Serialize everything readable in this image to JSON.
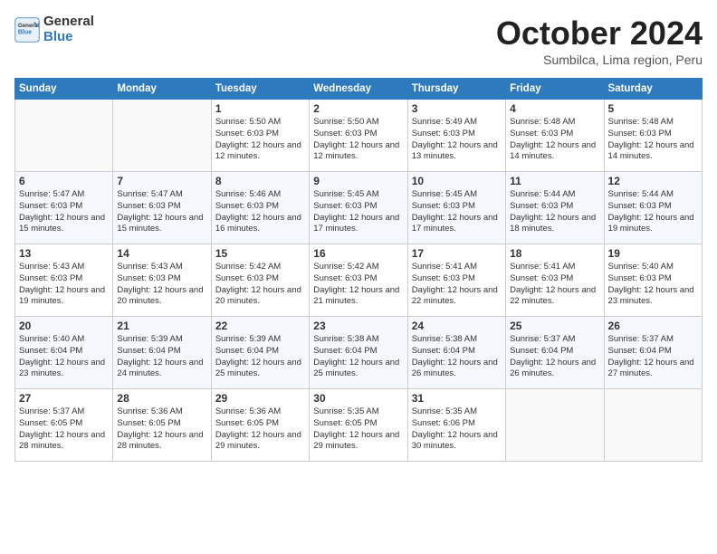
{
  "header": {
    "logo_general": "General",
    "logo_blue": "Blue",
    "month_title": "October 2024",
    "subtitle": "Sumbilca, Lima region, Peru"
  },
  "weekdays": [
    "Sunday",
    "Monday",
    "Tuesday",
    "Wednesday",
    "Thursday",
    "Friday",
    "Saturday"
  ],
  "weeks": [
    [
      {
        "day": "",
        "info": ""
      },
      {
        "day": "",
        "info": ""
      },
      {
        "day": "1",
        "info": "Sunrise: 5:50 AM\nSunset: 6:03 PM\nDaylight: 12 hours and 12 minutes."
      },
      {
        "day": "2",
        "info": "Sunrise: 5:50 AM\nSunset: 6:03 PM\nDaylight: 12 hours and 12 minutes."
      },
      {
        "day": "3",
        "info": "Sunrise: 5:49 AM\nSunset: 6:03 PM\nDaylight: 12 hours and 13 minutes."
      },
      {
        "day": "4",
        "info": "Sunrise: 5:48 AM\nSunset: 6:03 PM\nDaylight: 12 hours and 14 minutes."
      },
      {
        "day": "5",
        "info": "Sunrise: 5:48 AM\nSunset: 6:03 PM\nDaylight: 12 hours and 14 minutes."
      }
    ],
    [
      {
        "day": "6",
        "info": "Sunrise: 5:47 AM\nSunset: 6:03 PM\nDaylight: 12 hours and 15 minutes."
      },
      {
        "day": "7",
        "info": "Sunrise: 5:47 AM\nSunset: 6:03 PM\nDaylight: 12 hours and 15 minutes."
      },
      {
        "day": "8",
        "info": "Sunrise: 5:46 AM\nSunset: 6:03 PM\nDaylight: 12 hours and 16 minutes."
      },
      {
        "day": "9",
        "info": "Sunrise: 5:45 AM\nSunset: 6:03 PM\nDaylight: 12 hours and 17 minutes."
      },
      {
        "day": "10",
        "info": "Sunrise: 5:45 AM\nSunset: 6:03 PM\nDaylight: 12 hours and 17 minutes."
      },
      {
        "day": "11",
        "info": "Sunrise: 5:44 AM\nSunset: 6:03 PM\nDaylight: 12 hours and 18 minutes."
      },
      {
        "day": "12",
        "info": "Sunrise: 5:44 AM\nSunset: 6:03 PM\nDaylight: 12 hours and 19 minutes."
      }
    ],
    [
      {
        "day": "13",
        "info": "Sunrise: 5:43 AM\nSunset: 6:03 PM\nDaylight: 12 hours and 19 minutes."
      },
      {
        "day": "14",
        "info": "Sunrise: 5:43 AM\nSunset: 6:03 PM\nDaylight: 12 hours and 20 minutes."
      },
      {
        "day": "15",
        "info": "Sunrise: 5:42 AM\nSunset: 6:03 PM\nDaylight: 12 hours and 20 minutes."
      },
      {
        "day": "16",
        "info": "Sunrise: 5:42 AM\nSunset: 6:03 PM\nDaylight: 12 hours and 21 minutes."
      },
      {
        "day": "17",
        "info": "Sunrise: 5:41 AM\nSunset: 6:03 PM\nDaylight: 12 hours and 22 minutes."
      },
      {
        "day": "18",
        "info": "Sunrise: 5:41 AM\nSunset: 6:03 PM\nDaylight: 12 hours and 22 minutes."
      },
      {
        "day": "19",
        "info": "Sunrise: 5:40 AM\nSunset: 6:03 PM\nDaylight: 12 hours and 23 minutes."
      }
    ],
    [
      {
        "day": "20",
        "info": "Sunrise: 5:40 AM\nSunset: 6:04 PM\nDaylight: 12 hours and 23 minutes."
      },
      {
        "day": "21",
        "info": "Sunrise: 5:39 AM\nSunset: 6:04 PM\nDaylight: 12 hours and 24 minutes."
      },
      {
        "day": "22",
        "info": "Sunrise: 5:39 AM\nSunset: 6:04 PM\nDaylight: 12 hours and 25 minutes."
      },
      {
        "day": "23",
        "info": "Sunrise: 5:38 AM\nSunset: 6:04 PM\nDaylight: 12 hours and 25 minutes."
      },
      {
        "day": "24",
        "info": "Sunrise: 5:38 AM\nSunset: 6:04 PM\nDaylight: 12 hours and 26 minutes."
      },
      {
        "day": "25",
        "info": "Sunrise: 5:37 AM\nSunset: 6:04 PM\nDaylight: 12 hours and 26 minutes."
      },
      {
        "day": "26",
        "info": "Sunrise: 5:37 AM\nSunset: 6:04 PM\nDaylight: 12 hours and 27 minutes."
      }
    ],
    [
      {
        "day": "27",
        "info": "Sunrise: 5:37 AM\nSunset: 6:05 PM\nDaylight: 12 hours and 28 minutes."
      },
      {
        "day": "28",
        "info": "Sunrise: 5:36 AM\nSunset: 6:05 PM\nDaylight: 12 hours and 28 minutes."
      },
      {
        "day": "29",
        "info": "Sunrise: 5:36 AM\nSunset: 6:05 PM\nDaylight: 12 hours and 29 minutes."
      },
      {
        "day": "30",
        "info": "Sunrise: 5:35 AM\nSunset: 6:05 PM\nDaylight: 12 hours and 29 minutes."
      },
      {
        "day": "31",
        "info": "Sunrise: 5:35 AM\nSunset: 6:06 PM\nDaylight: 12 hours and 30 minutes."
      },
      {
        "day": "",
        "info": ""
      },
      {
        "day": "",
        "info": ""
      }
    ]
  ]
}
